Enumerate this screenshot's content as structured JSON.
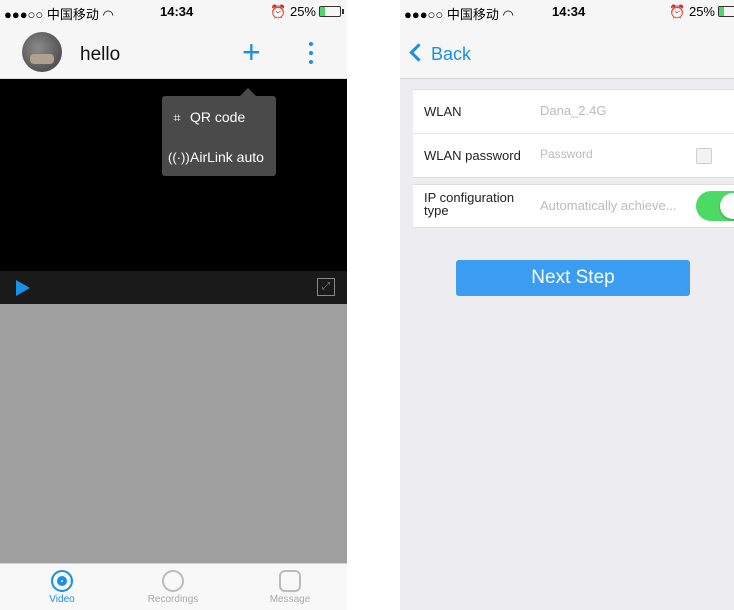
{
  "status_bar": {
    "carrier": "●●●○○ 中国移动 ",
    "time": "14:34",
    "battery": "25%"
  },
  "left": {
    "header": {
      "title": "hello"
    },
    "menu": [
      {
        "icon": "qr-code-icon",
        "glyph": "⌗",
        "label": "QR code"
      },
      {
        "icon": "airlink-icon",
        "glyph": "((·))",
        "label": "AirLink auto"
      }
    ],
    "tabs": [
      {
        "icon": "camera-icon",
        "label": "Video",
        "active": true
      },
      {
        "icon": "film-reel-icon",
        "label": "Recordings",
        "active": false
      },
      {
        "icon": "chat-bubble-icon",
        "label": "Message",
        "active": false
      }
    ]
  },
  "right": {
    "back_label": "Back",
    "fields": {
      "wlan_label": "WLAN",
      "wlan_value": "Dana_2.4G",
      "password_label": "WLAN password",
      "password_placeholder": "Password",
      "ip_label": "IP configuration type",
      "ip_value": "Automatically achieve...",
      "ip_toggle_on": true
    },
    "next_button": "Next Step"
  },
  "colors": {
    "accent": "#1a8fe6",
    "toggle_on": "#4cd964",
    "button": "#3a9df2"
  }
}
